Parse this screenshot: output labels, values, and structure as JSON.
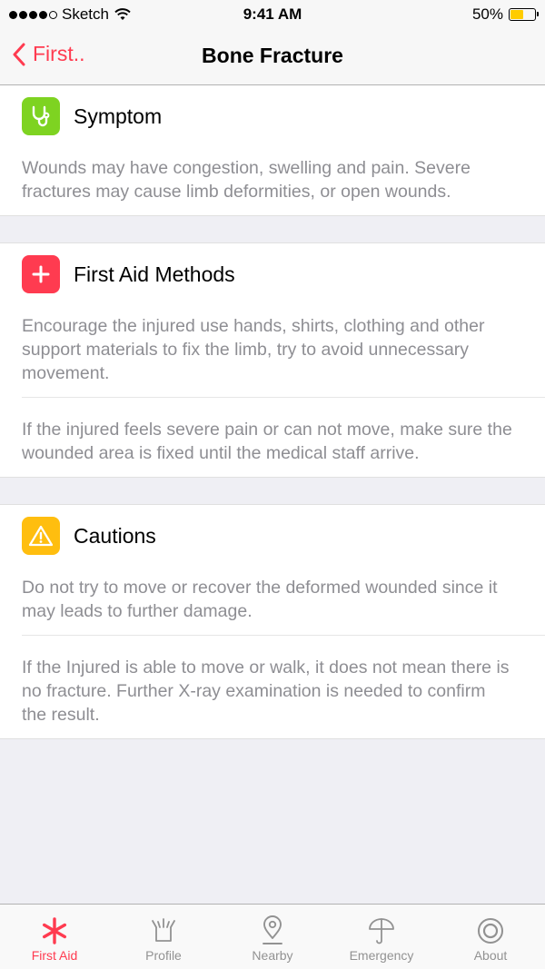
{
  "status_bar": {
    "carrier": "Sketch",
    "time": "9:41 AM",
    "battery": "50%"
  },
  "nav": {
    "back_label": "First..",
    "title": "Bone Fracture"
  },
  "sections": [
    {
      "title": "Symptom",
      "icon": "stethoscope-icon",
      "color": "#7ed321",
      "paragraphs": [
        "Wounds may have congestion, swelling and pain. Severe fractures may cause limb deformities, or open wounds."
      ]
    },
    {
      "title": "First Aid Methods",
      "icon": "plus-icon",
      "color": "#ff3b50",
      "paragraphs": [
        "Encourage the injured use hands, shirts, clothing and other support materials to fix the limb, try to avoid unnecessary movement.",
        "If the injured feels severe pain or can not move, make sure the wounded area is fixed until the medical staff arrive."
      ]
    },
    {
      "title": "Cautions",
      "icon": "warning-icon",
      "color": "#ffbe0f",
      "paragraphs": [
        "Do not try to move or recover the deformed wounded since it may leads to further damage.",
        "If the Injured is able to move or walk, it does not mean there is no fracture. Further X-ray examination is needed to confirm the result."
      ]
    }
  ],
  "tabs": [
    {
      "label": "First Aid",
      "icon": "asterisk-icon",
      "active": true
    },
    {
      "label": "Profile",
      "icon": "profile-icon",
      "active": false
    },
    {
      "label": "Nearby",
      "icon": "location-pin-icon",
      "active": false
    },
    {
      "label": "Emergency",
      "icon": "umbrella-icon",
      "active": false
    },
    {
      "label": "About",
      "icon": "about-icon",
      "active": false
    }
  ],
  "colors": {
    "accent": "#ff3b50",
    "inactive_tab": "#929292",
    "body_text": "#8e8e93"
  }
}
